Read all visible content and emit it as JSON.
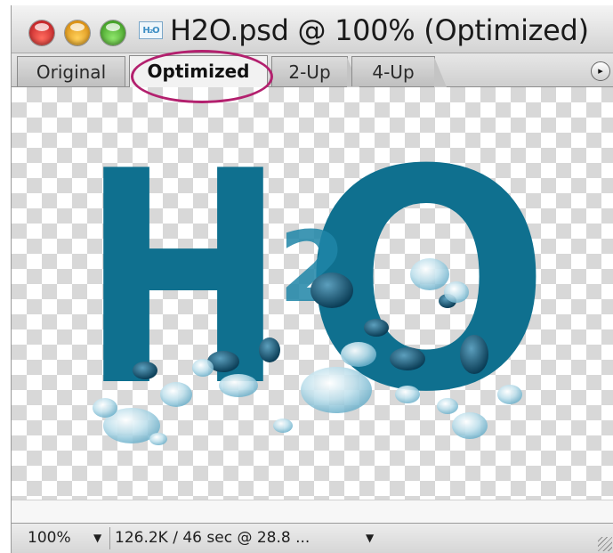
{
  "window": {
    "title": "H2O.psd @ 100% (Optimized)",
    "doc_icon_label": "H₂O"
  },
  "tabs": [
    {
      "label": "Original",
      "selected": false
    },
    {
      "label": "Optimized",
      "selected": true
    },
    {
      "label": "2-Up",
      "selected": false
    },
    {
      "label": "4-Up",
      "selected": false
    }
  ],
  "tab_menu_icon": "▸",
  "highlight_color": "#b3206e",
  "artwork": {
    "letter_1": "H",
    "letter_2": "2",
    "letter_3": "O",
    "fill_color": "#0f708f",
    "drop_color": "#a9d3e3"
  },
  "status": {
    "zoom": "100%",
    "zoom_arrow": "▼",
    "info": "126.2K / 46 sec @ 28.8 ...",
    "info_arrow": "▼"
  }
}
